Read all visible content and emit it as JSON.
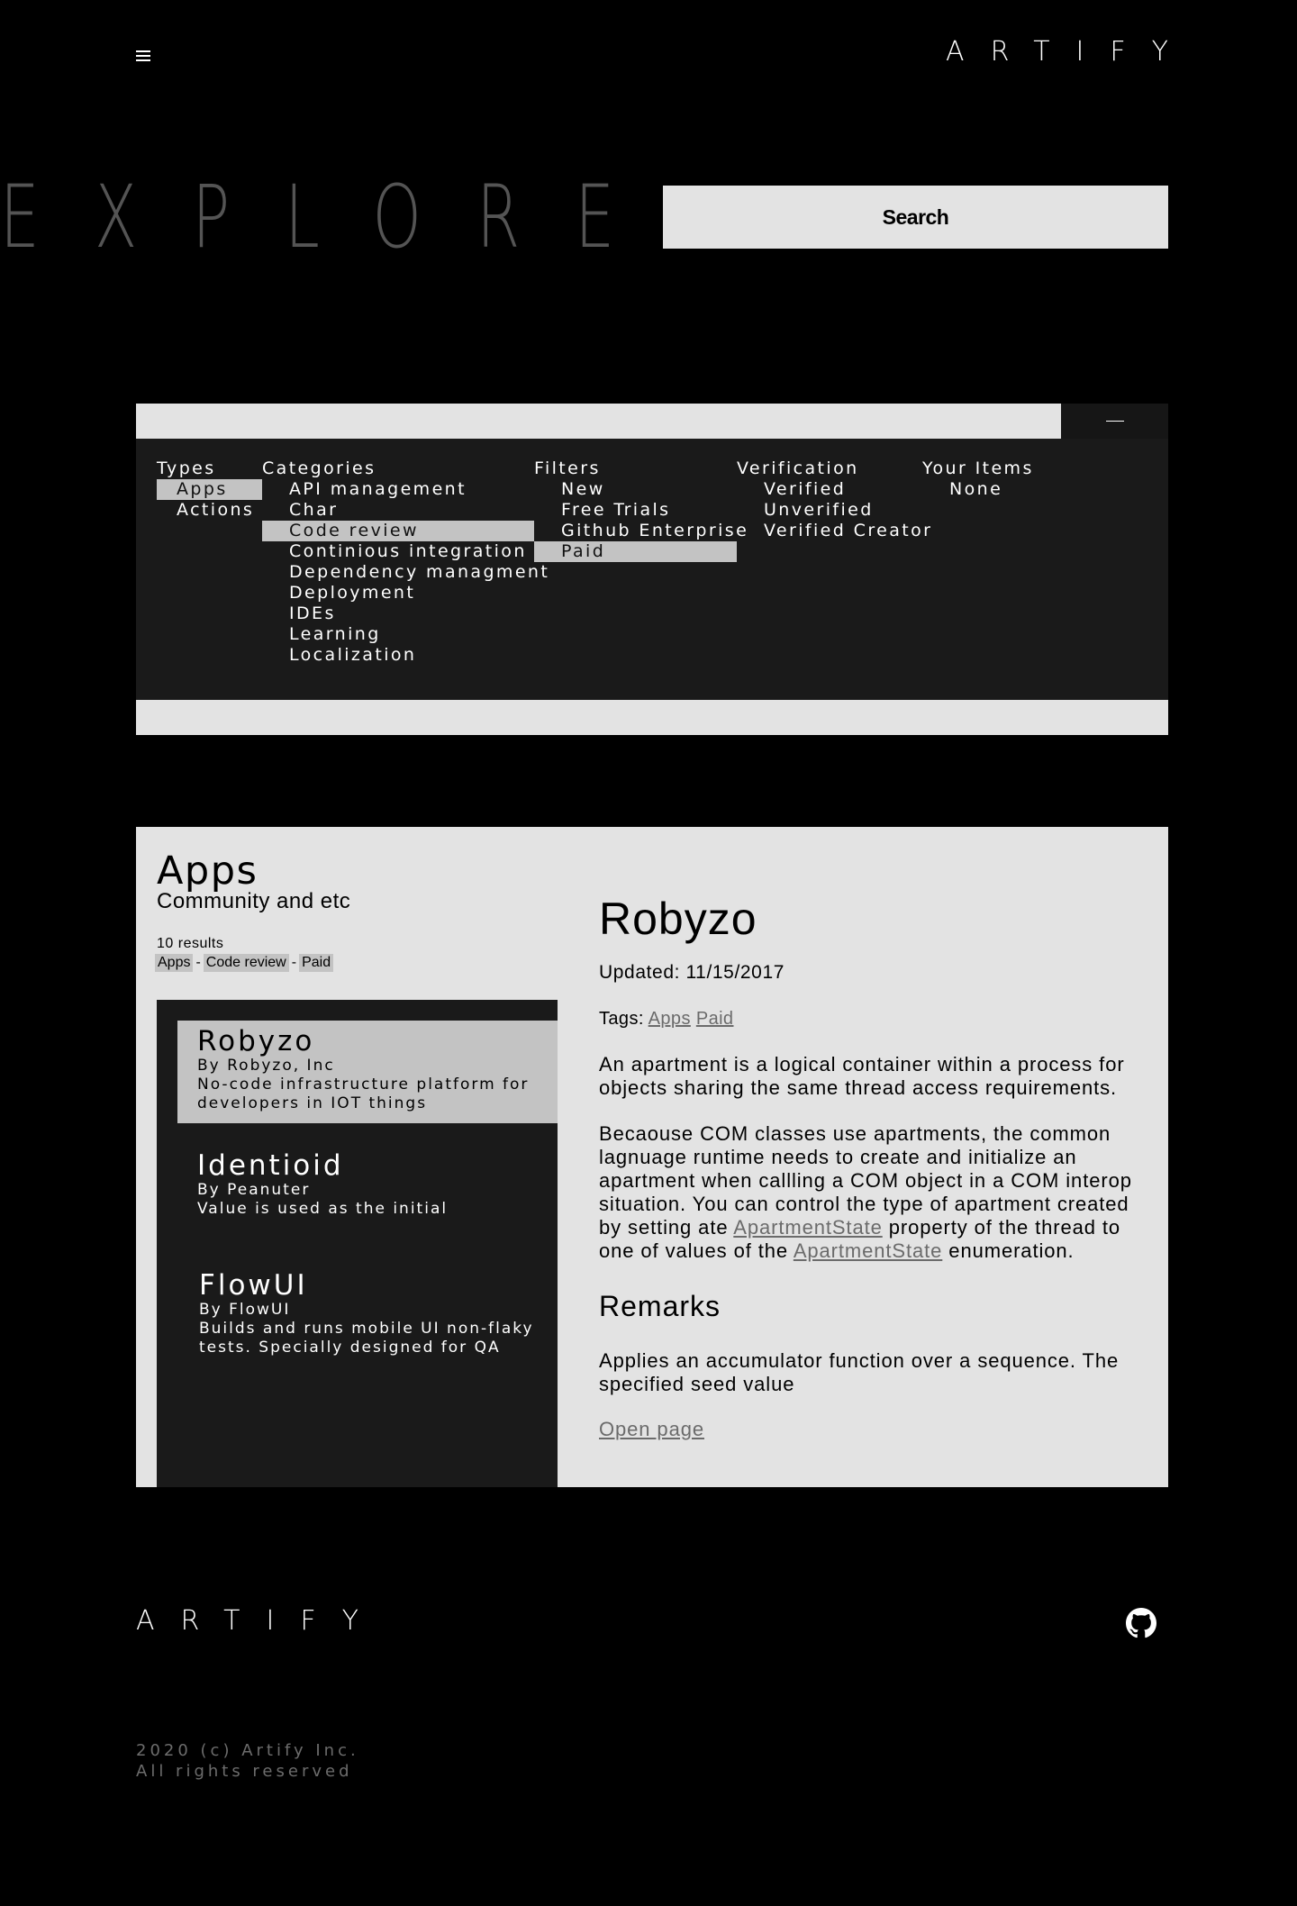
{
  "header": {
    "logo": "ARTIFY",
    "menu_icon": "hamburger-icon"
  },
  "hero": {
    "title": "EXPLORE",
    "search_label": "Search"
  },
  "filters": {
    "columns": [
      {
        "heading": "Types",
        "options": [
          "Apps",
          "Actions"
        ],
        "selected": [
          0
        ]
      },
      {
        "heading": "Categories",
        "options": [
          "API management",
          "Char",
          "Code review",
          "Continious integration",
          "Dependency managment",
          "Deployment",
          "IDEs",
          "Learning",
          "Localization"
        ],
        "selected": [
          2
        ]
      },
      {
        "heading": "Filters",
        "options": [
          "New",
          "Free Trials",
          "Github Enterprise",
          "Paid"
        ],
        "selected": [
          3
        ]
      },
      {
        "heading": "Verification",
        "options": [
          "Verified",
          "Unverified",
          "Verified Creator"
        ],
        "selected": []
      },
      {
        "heading": "Your Items",
        "options": [
          "None"
        ],
        "selected": []
      }
    ],
    "collapse_icon": "minus-icon"
  },
  "listing": {
    "title": "Apps",
    "subtitle": "Community and etc",
    "results": "10 results",
    "chips": [
      "Apps",
      "Code review",
      "Paid"
    ],
    "chip_separator": "-",
    "items": [
      {
        "name": "Robyzo",
        "by": "By Robyzo, Inc",
        "desc": "No-code infrastructure platform for developers in IOT things",
        "selected": true
      },
      {
        "name": "Identioid",
        "by": "By Peanuter",
        "desc": "Value is used as the initial",
        "selected": false
      },
      {
        "name": "FlowUI",
        "by": "By FlowUI",
        "desc": "Builds and runs mobile UI non-flaky tests. Specially designed for QA",
        "selected": false
      }
    ]
  },
  "detail": {
    "title": "Robyzo",
    "updated": "Updated: 11/15/2017",
    "tags_label": "Tags:",
    "tags": [
      "Apps",
      "Paid"
    ],
    "para1": "An apartment is a logical container within a process for objects sharing the same thread access requirements.",
    "para2_a": "Becaouse COM classes use apartments, the common lagnuage runtime needs to create and initialize an apartment when callling a COM object in a COM interop situation. You can control the type of apartment created by setting ate ",
    "para2_link1": "ApartmentState",
    "para2_b": " property of the thread to one of values of the ",
    "para2_link2": "ApartmentState",
    "para2_c": " enumeration.",
    "remarks_title": "Remarks",
    "remarks_text": "Applies an accumulator function over a sequence. The specified seed value",
    "open_page": "Open page"
  },
  "footer": {
    "logo": "ARTIFY",
    "github_icon": "github-icon",
    "copyright_line1": "2020 (c) Artify Inc.",
    "copyright_line2": "All rights reserved"
  }
}
